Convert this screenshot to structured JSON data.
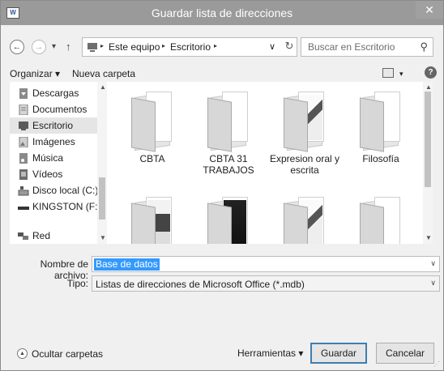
{
  "window": {
    "app_icon_text": "W",
    "title": "Guardar lista de direcciones",
    "close_glyph": "✕"
  },
  "address": {
    "back_glyph": "←",
    "forward_glyph": "→",
    "recent_glyph": "▾",
    "up_glyph": "↑",
    "crumbs": [
      "Este equipo",
      "Escritorio"
    ],
    "sep_glyph": "▸",
    "dropdown_glyph": "∨",
    "refresh_glyph": "↻",
    "search_placeholder": "Buscar en Escritorio",
    "search_glyph": "⚲"
  },
  "toolbar": {
    "organize_label": "Organizar ▾",
    "new_folder_label": "Nueva carpeta",
    "view_caret": "▾",
    "help_glyph": "?"
  },
  "nav": {
    "items": [
      {
        "label": "Descargas",
        "icon": "downloads-icon"
      },
      {
        "label": "Documentos",
        "icon": "documents-icon"
      },
      {
        "label": "Escritorio",
        "icon": "desktop-icon"
      },
      {
        "label": "Imágenes",
        "icon": "pictures-icon"
      },
      {
        "label": "Música",
        "icon": "music-icon"
      },
      {
        "label": "Vídeos",
        "icon": "videos-icon"
      },
      {
        "label": "Disco local (C:)",
        "icon": "drive-icon"
      },
      {
        "label": "KINGSTON (F:)",
        "icon": "usb-drive-icon"
      }
    ],
    "network_label": "Red",
    "selected": "Escritorio"
  },
  "folders": [
    {
      "name": "CBTA",
      "thumb": "none"
    },
    {
      "name": "CBTA 31 TRABAJOS",
      "thumb": "none"
    },
    {
      "name": "Expresion oral y escrita",
      "thumb": "document"
    },
    {
      "name": "Filosofía",
      "thumb": "none"
    },
    {
      "name": "",
      "thumb": "dark"
    },
    {
      "name": "",
      "thumb": "black"
    },
    {
      "name": "",
      "thumb": "document"
    },
    {
      "name": "",
      "thumb": "none"
    }
  ],
  "form": {
    "filename_label": "Nombre de archivo:",
    "filename_value": "Base de datos",
    "type_label": "Tipo:",
    "type_value": "Listas de direcciones de Microsoft Office (*.mdb)",
    "caret": "∨"
  },
  "footer": {
    "hide_folders_label": "Ocultar carpetas",
    "hide_glyph": "▲",
    "tools_label": "Herramientas  ▾",
    "save_label": "Guardar",
    "cancel_label": "Cancelar",
    "grip": "⋰"
  },
  "colors": {
    "titlebar": "#9a9a9a",
    "selection": "#3399ff",
    "default_button_border": "#3c7fb1"
  }
}
